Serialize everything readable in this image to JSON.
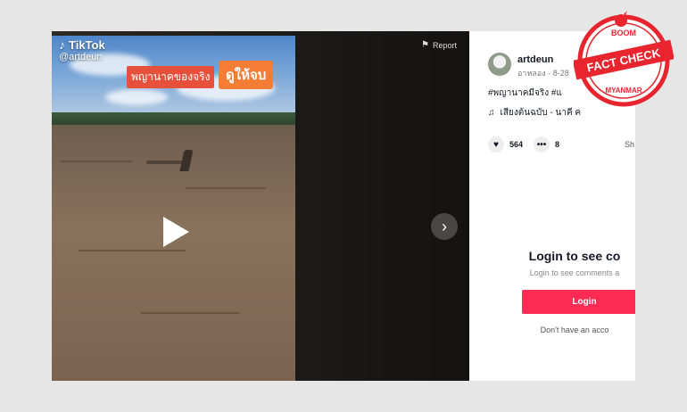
{
  "video": {
    "watermark_brand": "TikTok",
    "watermark_handle": "@artdeun",
    "overlay_left": "พญานาคของจริง",
    "overlay_right": "ดูให้จบ",
    "report_label": "Report"
  },
  "post": {
    "username": "artdeun",
    "subline": "อาหลอง · 8-28",
    "hashtags": "#พญานาคมีจริง #แ",
    "music": "เสียงต้นฉบับ - นาคี ค",
    "likes": "564",
    "comments": "8",
    "share_label": "Sh"
  },
  "login": {
    "title": "Login to see co",
    "subtitle": "Login to see comments a",
    "button": "Login",
    "no_account": "Don't have an acco"
  },
  "stamp": {
    "top": "BOOM",
    "main": "FACT CHECK",
    "bottom": "MYANMAR",
    "color": "#e8252f"
  },
  "colors": {
    "accent": "#fe2c55",
    "overlay_red": "#e7513b",
    "overlay_orange": "#f47d36"
  }
}
